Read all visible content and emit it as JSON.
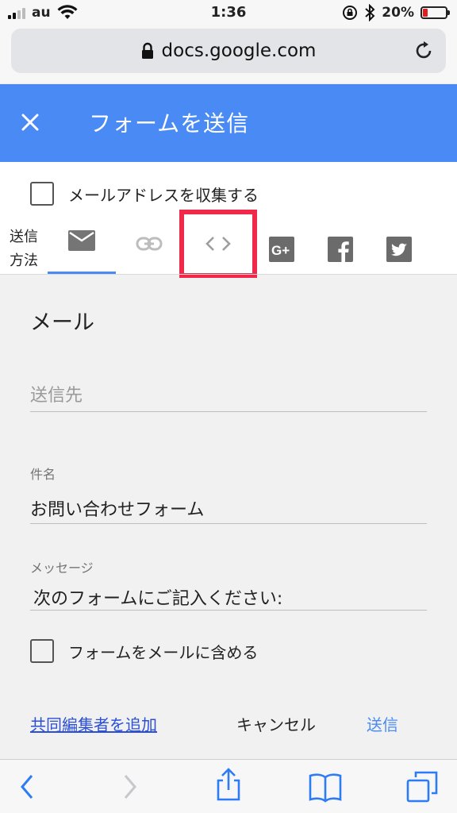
{
  "status_bar": {
    "carrier": "au",
    "time": "1:36",
    "battery_percent": "20%",
    "battery_level": 0.2,
    "battery_color": "#e21d1d"
  },
  "browser": {
    "url": "docs.google.com",
    "icons": [
      "lock-icon",
      "reload-icon"
    ]
  },
  "header": {
    "title": "フォームを送信",
    "color": "#4a8af4"
  },
  "collect_email_label": "メールアドレスを収集する",
  "send_method": {
    "label_line1": "送信",
    "label_line2": "方法",
    "tabs": [
      "email-icon",
      "link-icon",
      "embed-code-icon",
      "google-plus-icon",
      "facebook-icon",
      "twitter-icon"
    ],
    "selected": "email-icon"
  },
  "mail": {
    "title": "メール",
    "to_placeholder": "送信先",
    "subject_label": "件名",
    "subject_value": "お問い合わせフォーム",
    "message_label": "メッセージ",
    "message_value": "次のフォームにご記入ください:",
    "include_form_label": "フォームをメールに含める"
  },
  "actions": {
    "add_collaborators": "共同編集者を追加",
    "cancel": "キャンセル",
    "send": "送信"
  },
  "colors": {
    "accent": "#4a8af4",
    "highlight": "#f0294a",
    "ios_blue": "#2b7cf6"
  }
}
